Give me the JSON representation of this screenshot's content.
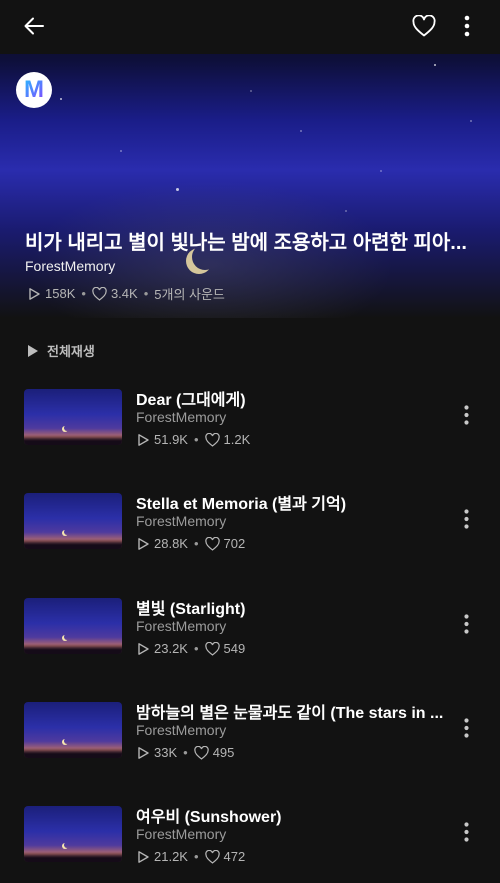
{
  "topbar": {
    "back_icon": "arrow-left-icon",
    "like_icon": "heart-outline-icon",
    "more_icon": "kebab-vertical-icon"
  },
  "playlist": {
    "logo_letter": "M",
    "title": "비가 내리고 별이 빛나는 밤에 조용하고 아련한 피아...",
    "artist": "ForestMemory",
    "plays": "158K",
    "likes": "3.4K",
    "sounds": "5개의 사운드"
  },
  "play_all_label": "전체재생",
  "tracks": [
    {
      "title": "Dear (그대에게)",
      "artist": "ForestMemory",
      "plays": "51.9K",
      "likes": "1.2K"
    },
    {
      "title": "Stella et Memoria (별과 기억)",
      "artist": "ForestMemory",
      "plays": "28.8K",
      "likes": "702"
    },
    {
      "title": "별빛 (Starlight)",
      "artist": "ForestMemory",
      "plays": "23.2K",
      "likes": "549"
    },
    {
      "title": "밤하늘의 별은 눈물과도 같이 (The stars in ...",
      "artist": "ForestMemory",
      "plays": "33K",
      "likes": "495"
    },
    {
      "title": "여우비 (Sunshower)",
      "artist": "ForestMemory",
      "plays": "21.2K",
      "likes": "472"
    }
  ],
  "colors": {
    "background": "#121212",
    "text": "#ffffff",
    "muted": "#9b9b9b",
    "logo_accent": "#8a3cff"
  }
}
